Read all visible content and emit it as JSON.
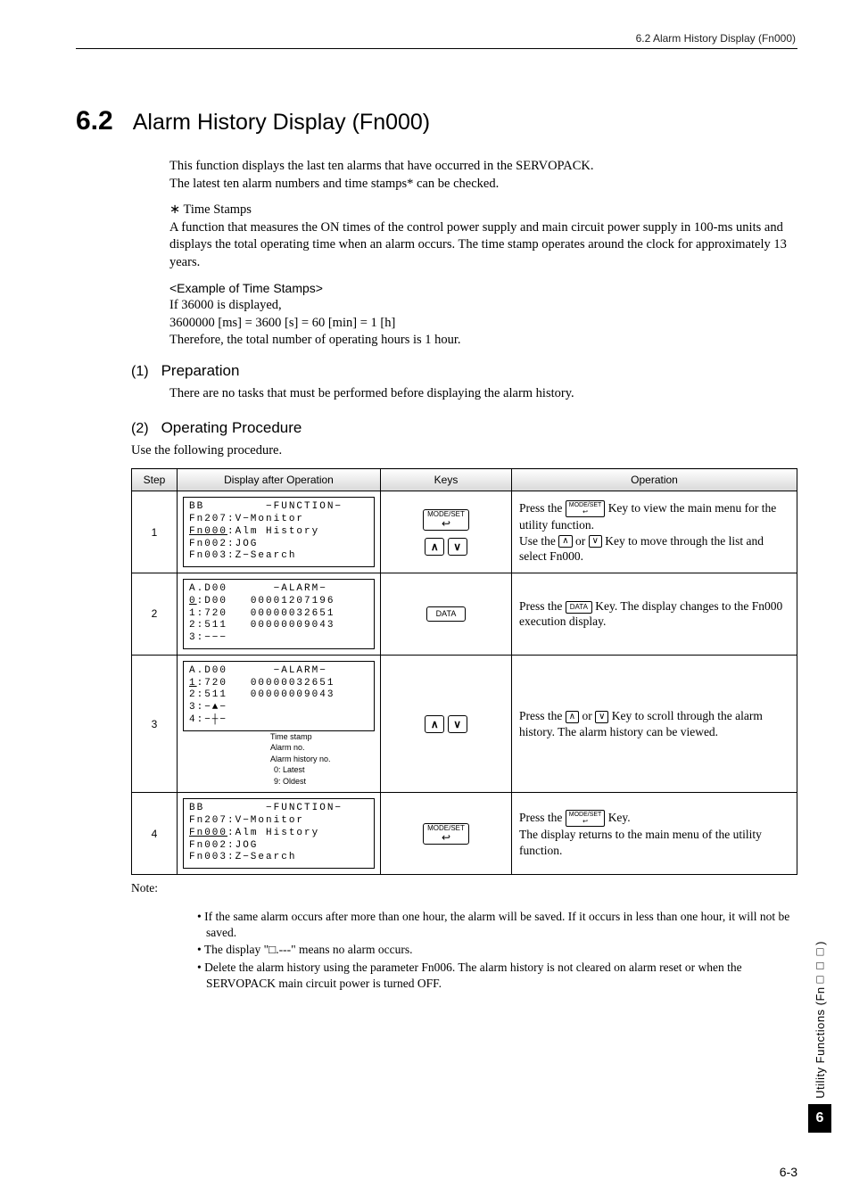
{
  "header": {
    "right_text": "6.2  Alarm History Display (Fn000)"
  },
  "section": {
    "number": "6.2",
    "title": "Alarm History Display (Fn000)"
  },
  "intro": {
    "p1": "This function displays the last ten alarms that have occurred in the SERVOPACK.",
    "p2": "The latest ten alarm numbers and time stamps* can be checked.",
    "star_label": "∗   Time Stamps",
    "star_body": "A function that measures the ON times of the control power supply and main circuit power supply in 100-ms units and displays the total operating time when an alarm occurs. The time stamp operates around the clock for approximately 13 years.",
    "example_title": "<Example of Time Stamps>",
    "example_l1": "If 36000 is displayed,",
    "example_l2": "3600000 [ms] = 3600 [s] =  60 [min] = 1 [h]",
    "example_l3": "Therefore, the total number of operating hours is 1 hour."
  },
  "sub1": {
    "num": "(1)",
    "title": "Preparation",
    "body": "There are no tasks that must be performed before displaying the alarm history."
  },
  "sub2": {
    "num": "(2)",
    "title": "Operating Procedure",
    "body": "Use the following procedure."
  },
  "table": {
    "headers": {
      "step": "Step",
      "display": "Display after Operation",
      "keys": "Keys",
      "op": "Operation"
    },
    "keys": {
      "modeset_label": "MODE/SET",
      "data_label": "DATA",
      "up": "∧",
      "down": "∨"
    },
    "rows": [
      {
        "step": "1",
        "display": [
          "BB        −FUNCTION−",
          "Fn207:V−Monitor",
          "|Fn000|:Alm History",
          "Fn002:JOG",
          "Fn003:Z−Search"
        ],
        "op_parts": {
          "a": "Press the ",
          "b": " Key to view the main menu for the utility function.",
          "c": "Use the ",
          "d": " or ",
          "e": " Key to move through the list and select Fn000."
        }
      },
      {
        "step": "2",
        "display": [
          "A.D00      −ALARM−",
          "|0|:D00   00001207196",
          "1:720   00000032651",
          "2:511   00000009043",
          "3:−−−"
        ],
        "op_parts": {
          "a": "Press the ",
          "b": " Key. The display changes to the Fn000 execution display."
        }
      },
      {
        "step": "3",
        "display": [
          "A.D00      −ALARM−",
          "|1|:720   00000032651",
          "2:511   00000009043",
          "3:−▲−",
          "4:−┼−"
        ],
        "annot": {
          "l1": "Time stamp",
          "l2": "Alarm no.",
          "l3": "Alarm history no.",
          "l4": "0: Latest",
          "l5": "9: Oldest"
        },
        "op_parts": {
          "a": "Press the ",
          "b": " or ",
          "c": " Key to scroll through the alarm history. The alarm history can be viewed."
        }
      },
      {
        "step": "4",
        "display": [
          "BB        −FUNCTION−",
          "Fn207:V−Monitor",
          "|Fn000|:Alm History",
          "Fn002:JOG",
          "Fn003:Z−Search"
        ],
        "op_parts": {
          "a": "Press the ",
          "b": " Key.",
          "c": "The display returns to the main menu of the utility function."
        }
      }
    ]
  },
  "notes": {
    "label": "Note:",
    "items": [
      "If the same alarm occurs after more than one hour, the alarm will be saved. If it occurs in less than one hour, it will not be saved.",
      "The display \"□.---\" means no alarm occurs.",
      "Delete the alarm history using the parameter Fn006. The alarm history is not cleared on alarm reset or when the SERVOPACK main circuit power is turned OFF."
    ]
  },
  "side": {
    "text": "Utility Functions (Fn□□□)",
    "chapter": "6"
  },
  "footer": {
    "page": "6-3"
  }
}
